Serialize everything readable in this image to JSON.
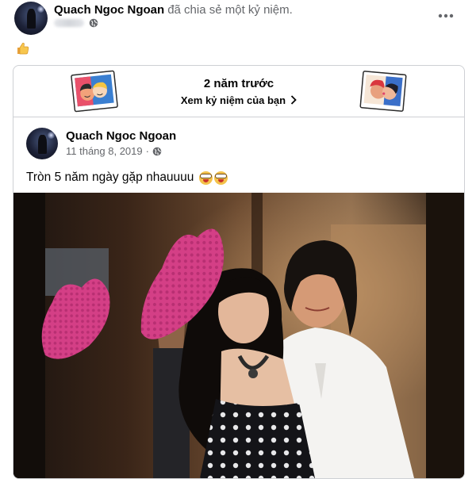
{
  "post": {
    "author": "Quach Ngoc Ngoan",
    "action": "đã chia sẻ một kỷ niệm.",
    "text_icon": "thumbs-up-emoji",
    "more_icon": "more-horizontal-icon",
    "privacy_icon": "globe-icon"
  },
  "memory": {
    "years_ago": "2 năm trước",
    "view_link": "Xem kỷ niệm của bạn",
    "left_sticker": "friends-sticker",
    "right_sticker": "couple-kiss-sticker"
  },
  "original_post": {
    "author": "Quach Ngoc Ngoan",
    "date": "11 tháng 8, 2019",
    "dot": "·",
    "text": "Tròn 5 năm ngày gặp nhauuuu",
    "emoji": [
      "grinning-face-emoji",
      "grinning-face-emoji"
    ]
  },
  "colors": {
    "name": "#050505",
    "meta": "#65676b",
    "border": "#ced0d4",
    "heart": "#d43f86"
  }
}
